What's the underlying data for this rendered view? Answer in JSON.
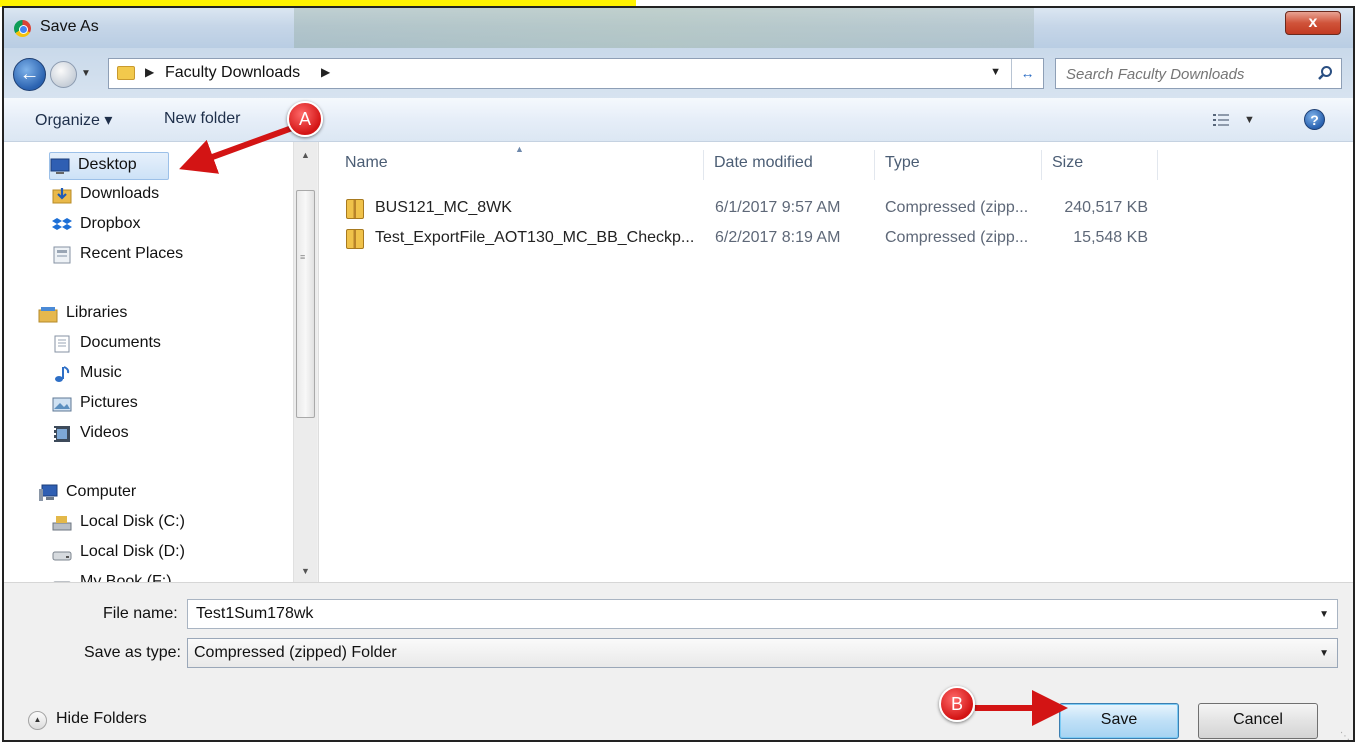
{
  "window": {
    "title": "Save As",
    "close_label": "x"
  },
  "address_bar": {
    "breadcrumb": "Faculty Downloads",
    "search_placeholder": "Search Faculty Downloads"
  },
  "toolbar": {
    "organize_label": "Organize ▾",
    "new_folder_label": "New folder",
    "help_label": "?"
  },
  "nav_pane": {
    "favorites": [
      {
        "label": "Desktop",
        "icon": "desktop-icon",
        "selected": true
      },
      {
        "label": "Downloads",
        "icon": "downloads-icon"
      },
      {
        "label": "Dropbox",
        "icon": "dropbox-icon"
      },
      {
        "label": "Recent Places",
        "icon": "recent-places-icon"
      }
    ],
    "libraries_header": "Libraries",
    "libraries": [
      {
        "label": "Documents",
        "icon": "documents-icon"
      },
      {
        "label": "Music",
        "icon": "music-icon"
      },
      {
        "label": "Pictures",
        "icon": "pictures-icon"
      },
      {
        "label": "Videos",
        "icon": "videos-icon"
      }
    ],
    "computer_header": "Computer",
    "drives": [
      {
        "label": "Local Disk (C:)",
        "icon": "local-disk-icon"
      },
      {
        "label": "Local Disk (D:)",
        "icon": "hard-drive-icon"
      },
      {
        "label": "My Book (F:)",
        "icon": "hard-drive-icon"
      }
    ]
  },
  "file_list": {
    "columns": [
      "Name",
      "Date modified",
      "Type",
      "Size"
    ],
    "rows": [
      {
        "name": "BUS121_MC_8WK",
        "date": "6/1/2017 9:57 AM",
        "type": "Compressed (zipp...",
        "size": "240,517 KB"
      },
      {
        "name": "Test_ExportFile_AOT130_MC_BB_Checkp...",
        "date": "6/2/2017 8:19 AM",
        "type": "Compressed (zipp...",
        "size": "15,548 KB"
      }
    ]
  },
  "form": {
    "file_name_label": "File name:",
    "file_name_value": "Test1Sum178wk",
    "save_type_label": "Save as type:",
    "save_type_value": "Compressed (zipped) Folder",
    "hide_folders_label": "Hide Folders",
    "save_label": "Save",
    "cancel_label": "Cancel"
  },
  "annotations": {
    "marker_a": "A",
    "marker_b": "B",
    "marker_color": "#d31414"
  }
}
